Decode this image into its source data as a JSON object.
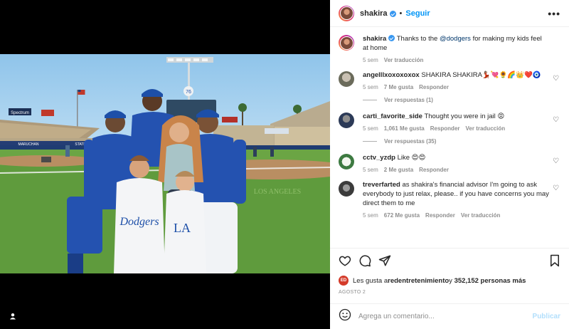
{
  "header": {
    "username": "shakira",
    "separator": "•",
    "follow_label": "Seguir",
    "more_label": "•••"
  },
  "caption": {
    "username": "shakira",
    "text_before": "Thanks to the ",
    "mention": "@dodgers",
    "text_after": " for making my kids feel at home",
    "age": "5 sem",
    "translate_label": "Ver traducción"
  },
  "comments": [
    {
      "username": "angelllxoxoxoxox",
      "text": "SHAKIRA SHAKIRA💃🏽💘🌻🌈👑❤️🧿",
      "age": "5 sem",
      "likes": "7 Me gusta",
      "reply_label": "Responder",
      "translate_label": "",
      "replies_label": "Ver respuestas (1)"
    },
    {
      "username": "carti_favorite_side",
      "text": "Thought you were in jail 😡",
      "age": "5 sem",
      "likes": "1,061 Me gusta",
      "reply_label": "Responder",
      "translate_label": "Ver traducción",
      "replies_label": "Ver respuestas (35)"
    },
    {
      "username": "cctv_yzdp",
      "text": "Like 😍😍",
      "age": "5 sem",
      "likes": "2 Me gusta",
      "reply_label": "Responder",
      "translate_label": "",
      "replies_label": ""
    },
    {
      "username": "treverfarted",
      "text": "as shakira's financial advisor I'm going to ask everybody to just relax, please.. if you have concerns you may direct them to me",
      "age": "5 sem",
      "likes": "672 Me gusta",
      "reply_label": "Responder",
      "translate_label": "Ver traducción",
      "replies_label": ""
    }
  ],
  "likes_line": {
    "prefix": "Les gusta a ",
    "first_user": "redentretenimiento",
    "middle": " y ",
    "count": "352,152 personas más",
    "mini_avatar": "ED"
  },
  "date": "AGOSTO 2",
  "composer": {
    "placeholder": "Agrega un comentario...",
    "publish_label": "Publicar"
  },
  "icons": {
    "like": "heart-icon",
    "comment": "comment-icon",
    "share": "share-icon",
    "save": "bookmark-icon",
    "emoji": "emoji-icon",
    "tag": "user-tag-icon"
  },
  "scene_text": {
    "scoreboard_number": "76",
    "sign_left": "Spectrum",
    "sign_middle_1": "MARUCHAN",
    "sign_right": "STATEFARM",
    "jersey_text": "Dodgers",
    "jersey_number": "LA",
    "field_text": "LOS ANGELES"
  },
  "colors": {
    "accent": "#0095f6",
    "dodger_blue": "#1d4fa8",
    "grass": "#5f9b3d"
  }
}
